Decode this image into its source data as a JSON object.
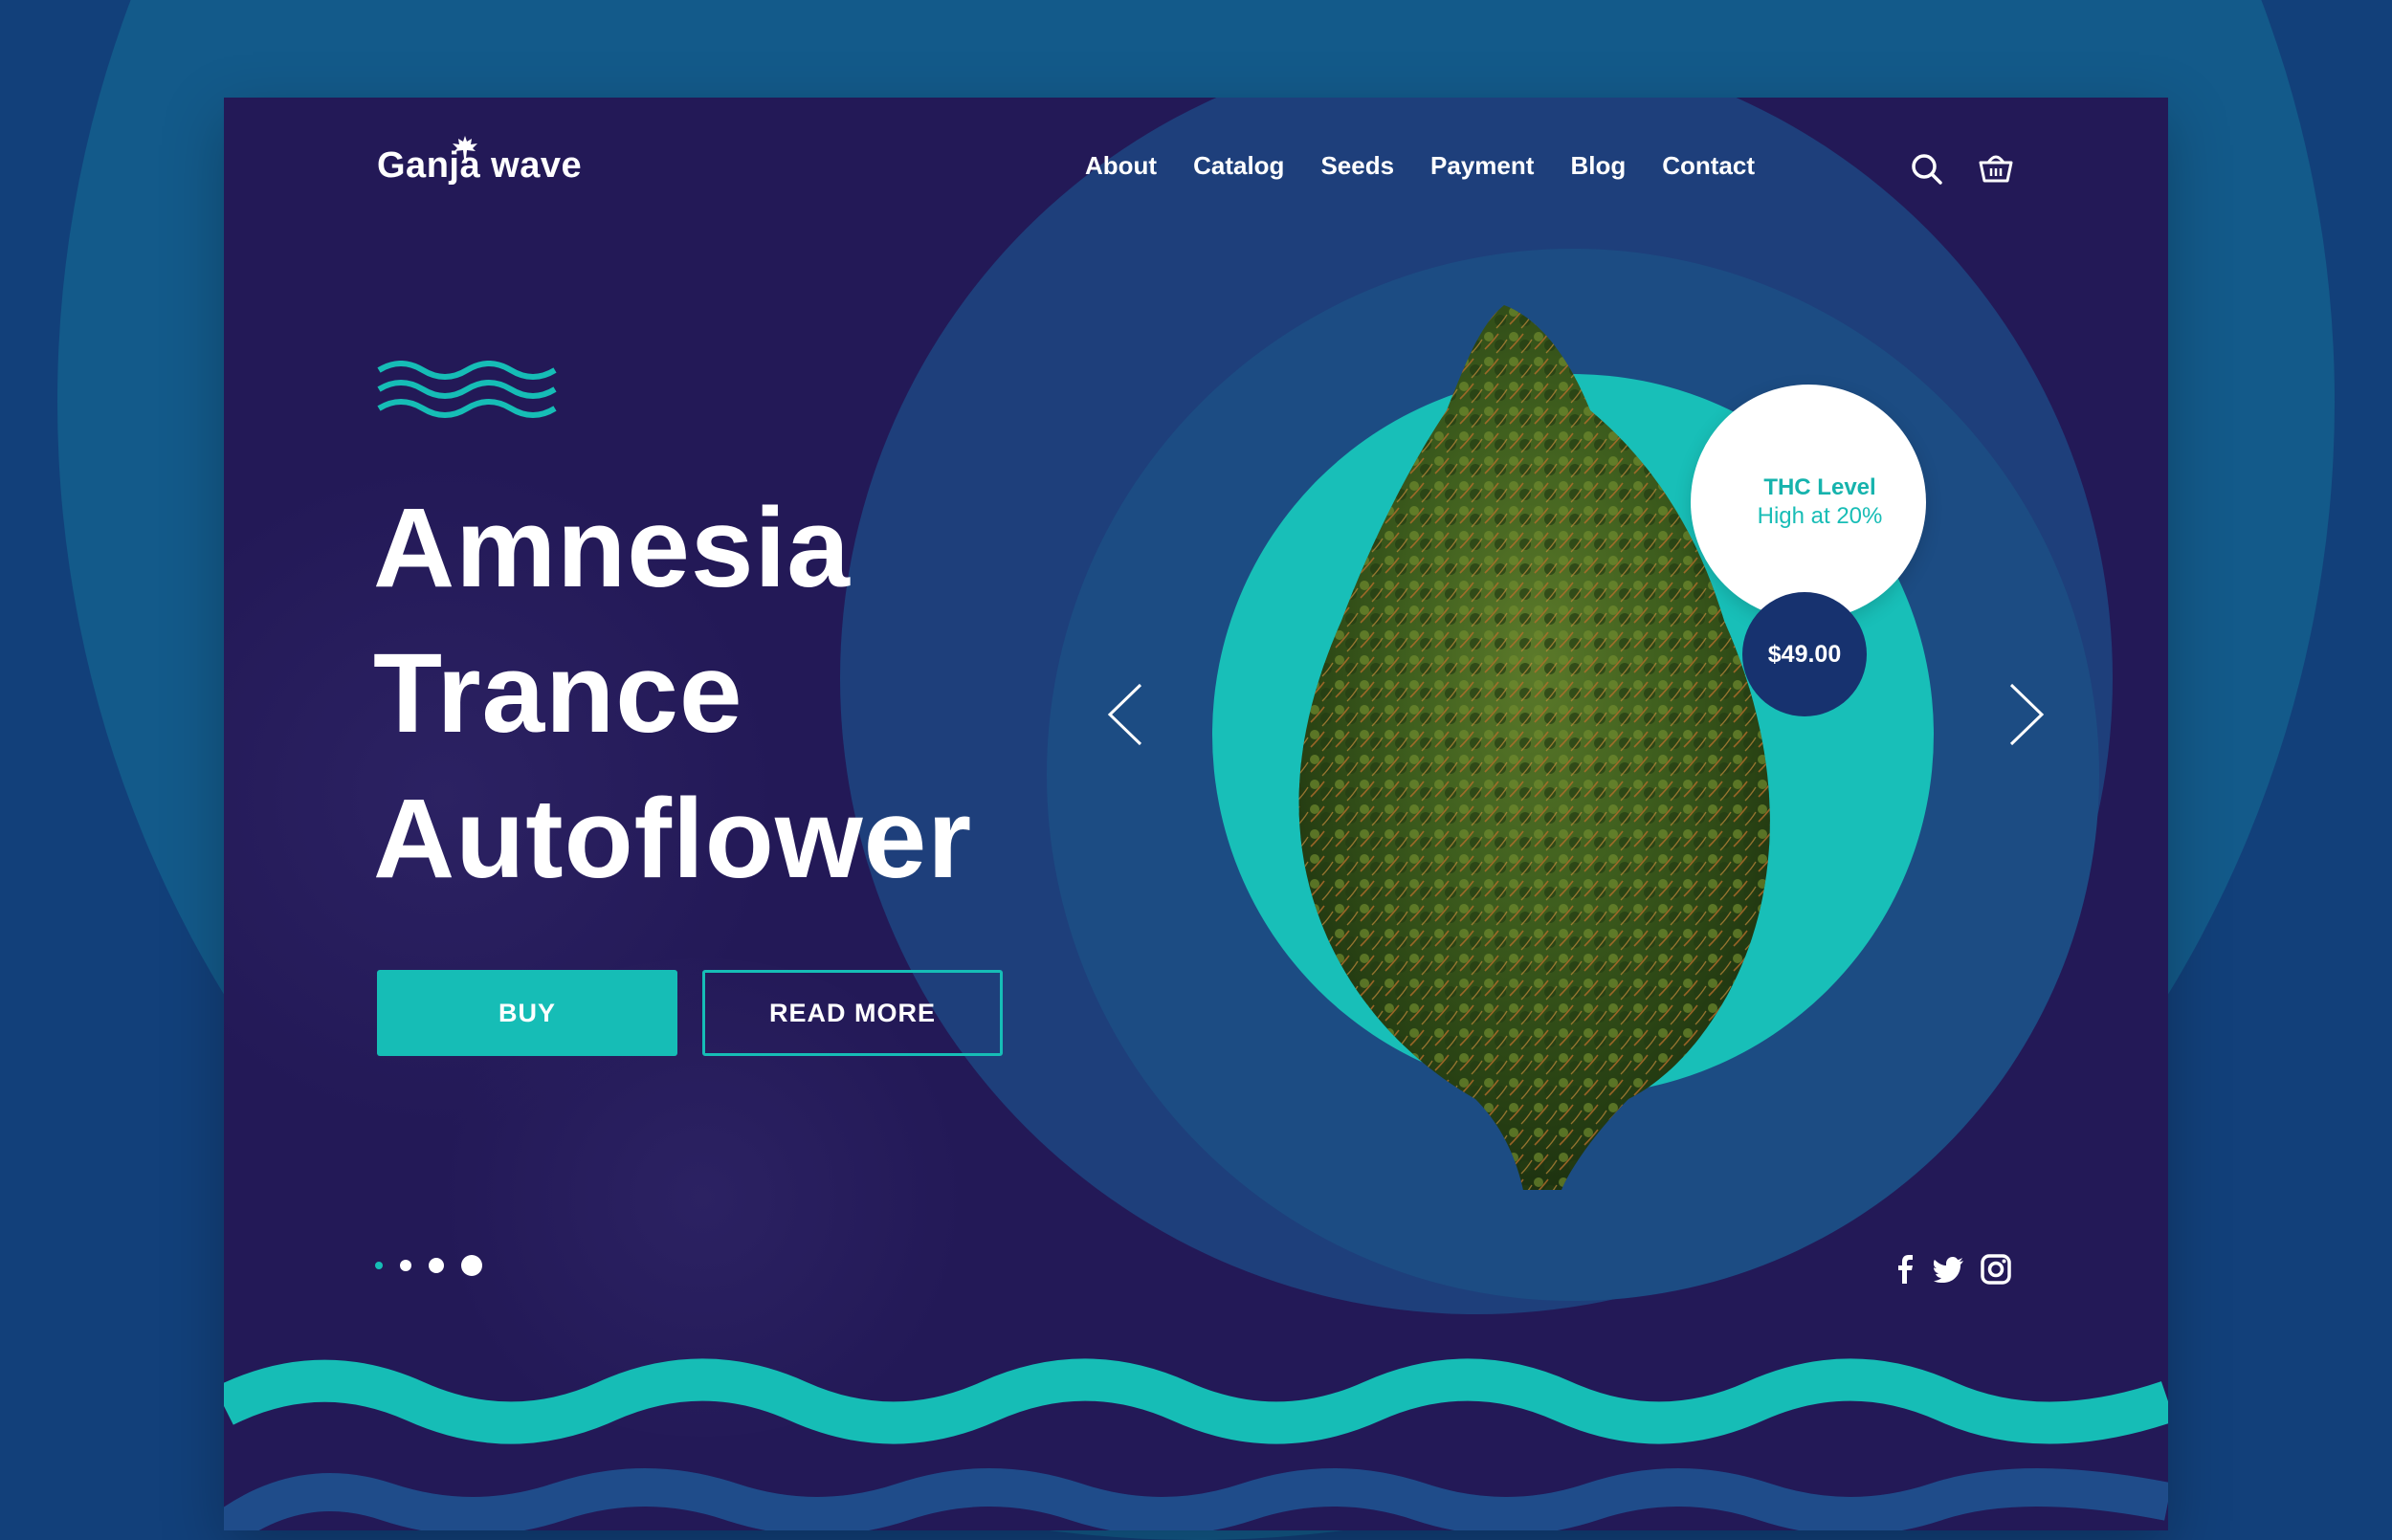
{
  "brand": {
    "name": "Ganja wave",
    "logo_icon": "maple-leaf-icon"
  },
  "nav": {
    "items": [
      "About",
      "Catalog",
      "Seeds",
      "Payment",
      "Blog",
      "Contact"
    ]
  },
  "header_icons": [
    "search-icon",
    "basket-icon"
  ],
  "hero": {
    "title_lines": [
      "Amnesia",
      "Trance",
      "Autoflower"
    ],
    "buy_label": "BUY",
    "read_more_label": "READ MORE"
  },
  "product": {
    "thc_title": "THC Level",
    "thc_value": "High at 20%",
    "price": "$49.00"
  },
  "slider": {
    "dots": 4,
    "active_index": 0
  },
  "social": [
    "facebook-icon",
    "twitter-icon",
    "instagram-icon"
  ],
  "colors": {
    "background": "#12407a",
    "panel": "#231957",
    "accent_teal": "#16bdb6",
    "price_badge": "#17326f",
    "text": "#ffffff"
  }
}
